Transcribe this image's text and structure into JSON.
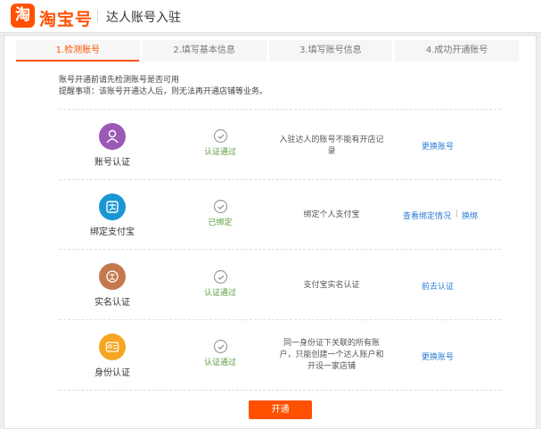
{
  "header": {
    "logo_char": "淘",
    "logo_text": "淘宝号",
    "title": "达人账号入驻"
  },
  "steps": [
    {
      "label": "1.检测账号",
      "active": true
    },
    {
      "label": "2.填写基本信息",
      "active": false
    },
    {
      "label": "3.填写账号信息",
      "active": false
    },
    {
      "label": "4.成功开通账号",
      "active": false
    }
  ],
  "intro": {
    "line1": "账号开通前请先检测账号是否可用",
    "line2": "提醒事项：该账号开通达人后，则无法再开通店铺等业务。"
  },
  "rows": [
    {
      "label": "账号认证",
      "icon": "person-icon",
      "icon_color": "#9b59b6",
      "status": "认证通过",
      "desc_lines": [
        "入驻达人的账号不能有开店记",
        "录"
      ],
      "actions": [
        "更换账号"
      ]
    },
    {
      "label": "绑定支付宝",
      "icon": "alipay-icon",
      "icon_color": "#1a96d4",
      "status": "已绑定",
      "desc_lines": [
        "绑定个人支付宝"
      ],
      "actions": [
        "查看绑定情况",
        "换绑"
      ]
    },
    {
      "label": "实名认证",
      "icon": "realname-icon",
      "icon_color": "#c4794e",
      "status": "认证通过",
      "desc_lines": [
        "支付宝实名认证"
      ],
      "actions": [
        "前去认证"
      ]
    },
    {
      "label": "身份认证",
      "icon": "id-card-icon",
      "icon_color": "#f5a623",
      "status": "认证通过",
      "desc_lines": [
        "同一身份证下关联的所有账",
        "户，只能创建一个达人账户和",
        "开设一家店铺"
      ],
      "actions": [
        "更换账号"
      ]
    }
  ],
  "submit_label": "开通"
}
